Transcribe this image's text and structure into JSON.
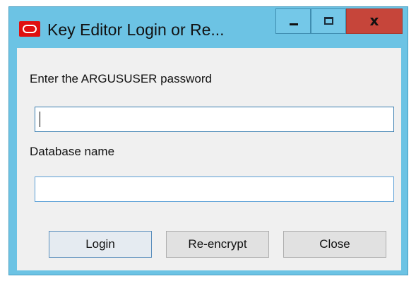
{
  "window": {
    "title": "Key Editor Login or Re...",
    "app_icon": "oracle-logo-icon",
    "frame_color": "#6cc3e4",
    "close_color": "#c6453a",
    "controls": {
      "minimize": "minimize-icon",
      "maximize": "maximize-icon",
      "close_glyph": "x"
    }
  },
  "form": {
    "password_label": "Enter the ARGUSUSER password",
    "password_value": "",
    "database_label": "Database name",
    "database_value": ""
  },
  "buttons": {
    "login": "Login",
    "reencrypt": "Re-encrypt",
    "close": "Close"
  }
}
